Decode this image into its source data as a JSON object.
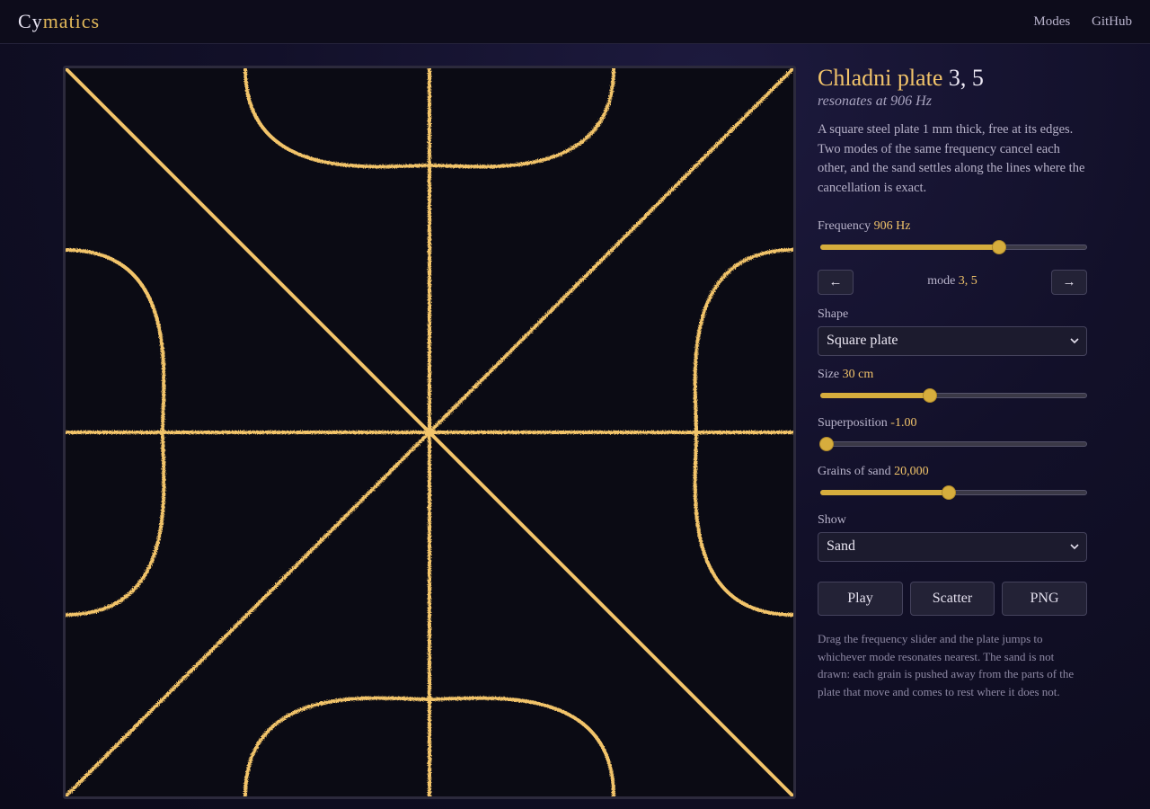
{
  "header": {
    "brand_part1": "Cy",
    "brand_part2": "matics",
    "nav": [
      "Modes",
      "GitHub"
    ]
  },
  "panel": {
    "title_text": "Chladni plate",
    "title_mode": "3, 5",
    "subtitle": "resonates at 906 Hz",
    "description": "A square steel plate 1 mm thick, free at its edges. Two modes of the same frequency cancel each other, and the sand settles along the lines where the cancellation is exact.",
    "frequency": {
      "label": "Frequency",
      "value": "906 Hz",
      "fraction": 0.67
    },
    "mode_nav": {
      "prev": "←",
      "next": "→",
      "label": "mode",
      "value": "3, 5"
    },
    "shape": {
      "label": "Shape",
      "value": "Square plate"
    },
    "size": {
      "label": "Size",
      "value": "30 cm",
      "fraction": 0.41
    },
    "superposition": {
      "label": "Superposition",
      "value": "-1.00",
      "fraction": 0.0
    },
    "grains": {
      "label": "Grains of sand",
      "value": "20,000",
      "fraction": 0.48
    },
    "show": {
      "label": "Show",
      "value": "Sand"
    },
    "buttons": {
      "play": "Play",
      "scatter": "Scatter",
      "png": "PNG"
    },
    "note": "Drag the frequency slider and the plate jumps to whichever mode resonates nearest. The sand is not drawn: each grain is pushed away from the parts of the plate that move and comes to rest where it does not."
  },
  "colors": {
    "sand": "#f2c46a",
    "accent": "#d6ad3d"
  }
}
